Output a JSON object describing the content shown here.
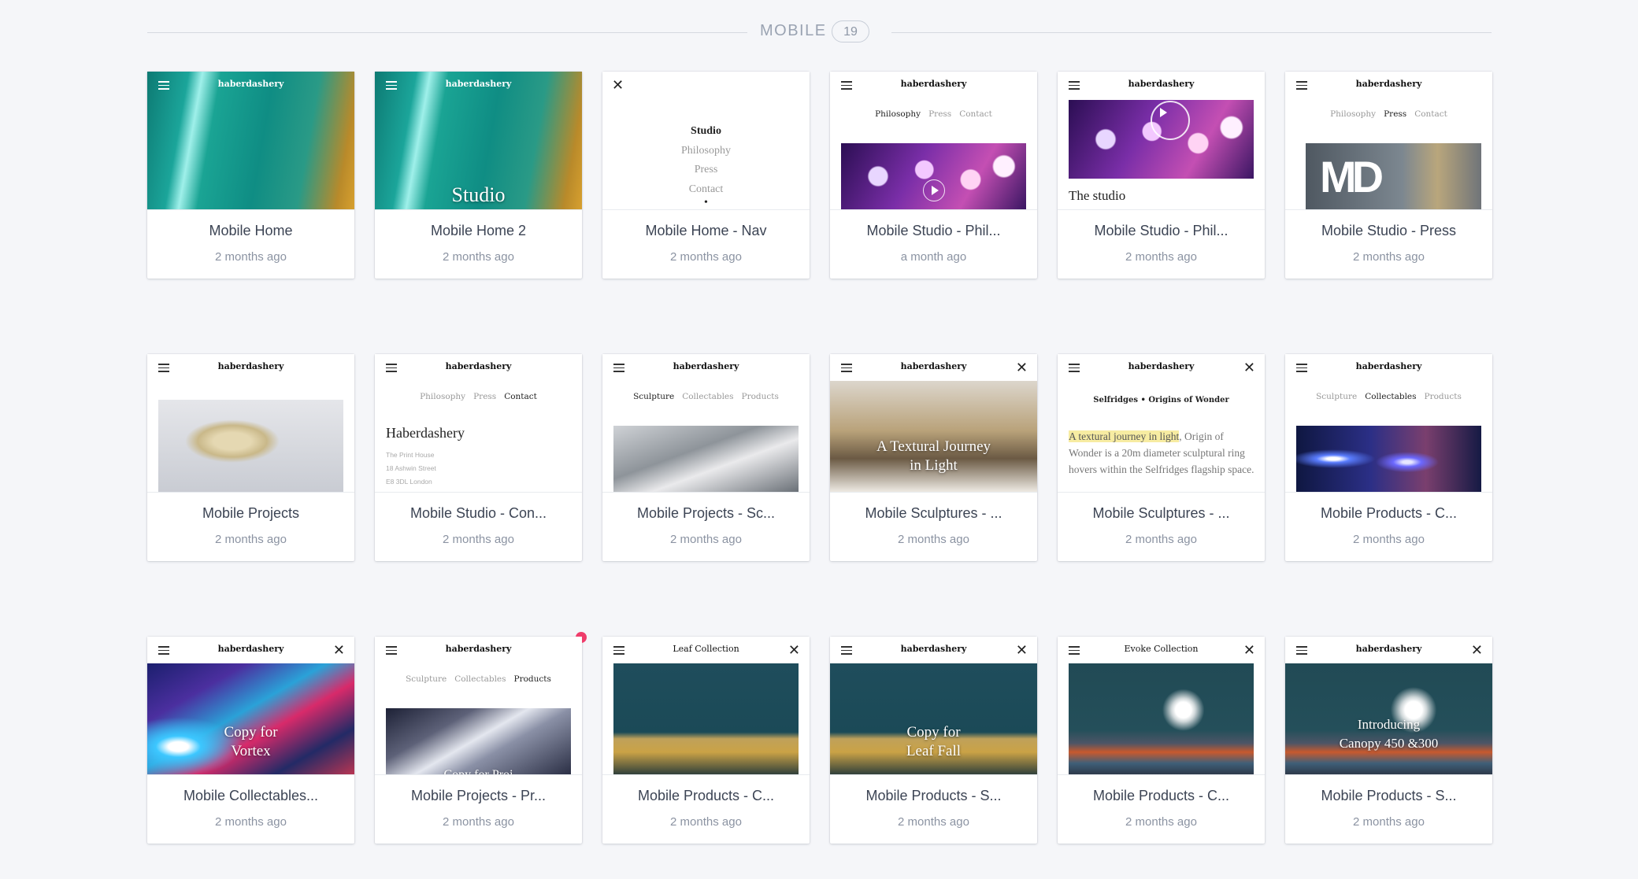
{
  "section": {
    "title": "MOBILE",
    "count": "19"
  },
  "mock": {
    "brand": "haberdashery",
    "nav": [
      "Studio",
      "Philosophy",
      "Press",
      "Contact"
    ],
    "studio_tabs": [
      "Philosophy",
      "Press",
      "Contact"
    ],
    "product_tabs": [
      "Sculpture",
      "Collectables",
      "Products"
    ],
    "overlay_studio": "Studio",
    "the_studio": "The studio",
    "md_logo": "MD",
    "contact_heading": "Haberdashery",
    "contact_lines": [
      "The Print House",
      "18 Ashwin Street",
      "E8 3DL London"
    ],
    "sculpture_overlay_1": "A Textural Journey",
    "sculpture_overlay_2": "in Light",
    "selfridges_heading": "Selfridges • Origins of Wonder",
    "selfridges_highlight": "A textural journey in light",
    "selfridges_body": ", Origin of Wonder is a 20m diameter sculptural ring hovers within the Selfridges flagship space.",
    "vortex_1": "Copy for",
    "vortex_2": "Vortex",
    "projects_overlay": "Copy for Proj",
    "leaf_collection": "Leaf Collection",
    "leaf_fall_1": "Copy for",
    "leaf_fall_2": "Leaf Fall",
    "evoke_collection": "Evoke Collection",
    "canopy_1": "Introducing",
    "canopy_2": "Canopy 450 &300"
  },
  "cards": [
    {
      "title": "Mobile Home",
      "meta": "2 months ago"
    },
    {
      "title": "Mobile Home 2",
      "meta": "2 months ago"
    },
    {
      "title": "Mobile Home - Nav",
      "meta": "2 months ago"
    },
    {
      "title": "Mobile Studio - Phil...",
      "meta": "a month ago"
    },
    {
      "title": "Mobile Studio - Phil...",
      "meta": "2 months ago"
    },
    {
      "title": "Mobile Studio - Press",
      "meta": "2 months ago"
    },
    {
      "title": "Mobile Projects",
      "meta": "2 months ago"
    },
    {
      "title": "Mobile Studio - Con...",
      "meta": "2 months ago"
    },
    {
      "title": "Mobile Projects - Sc...",
      "meta": "2 months ago"
    },
    {
      "title": "Mobile Sculptures - ...",
      "meta": "2 months ago"
    },
    {
      "title": "Mobile Sculptures - ...",
      "meta": "2 months ago"
    },
    {
      "title": "Mobile Products - C...",
      "meta": "2 months ago"
    },
    {
      "title": "Mobile Collectables...",
      "meta": "2 months ago"
    },
    {
      "title": "Mobile Projects - Pr...",
      "meta": "2 months ago"
    },
    {
      "title": "Mobile Products - C...",
      "meta": "2 months ago"
    },
    {
      "title": "Mobile Products - S...",
      "meta": "2 months ago"
    },
    {
      "title": "Mobile Products - C...",
      "meta": "2 months ago"
    },
    {
      "title": "Mobile Products - S...",
      "meta": "2 months ago"
    }
  ],
  "colors": {
    "notification_dot": "#ef3d6b",
    "background": "#f5f6f9"
  }
}
